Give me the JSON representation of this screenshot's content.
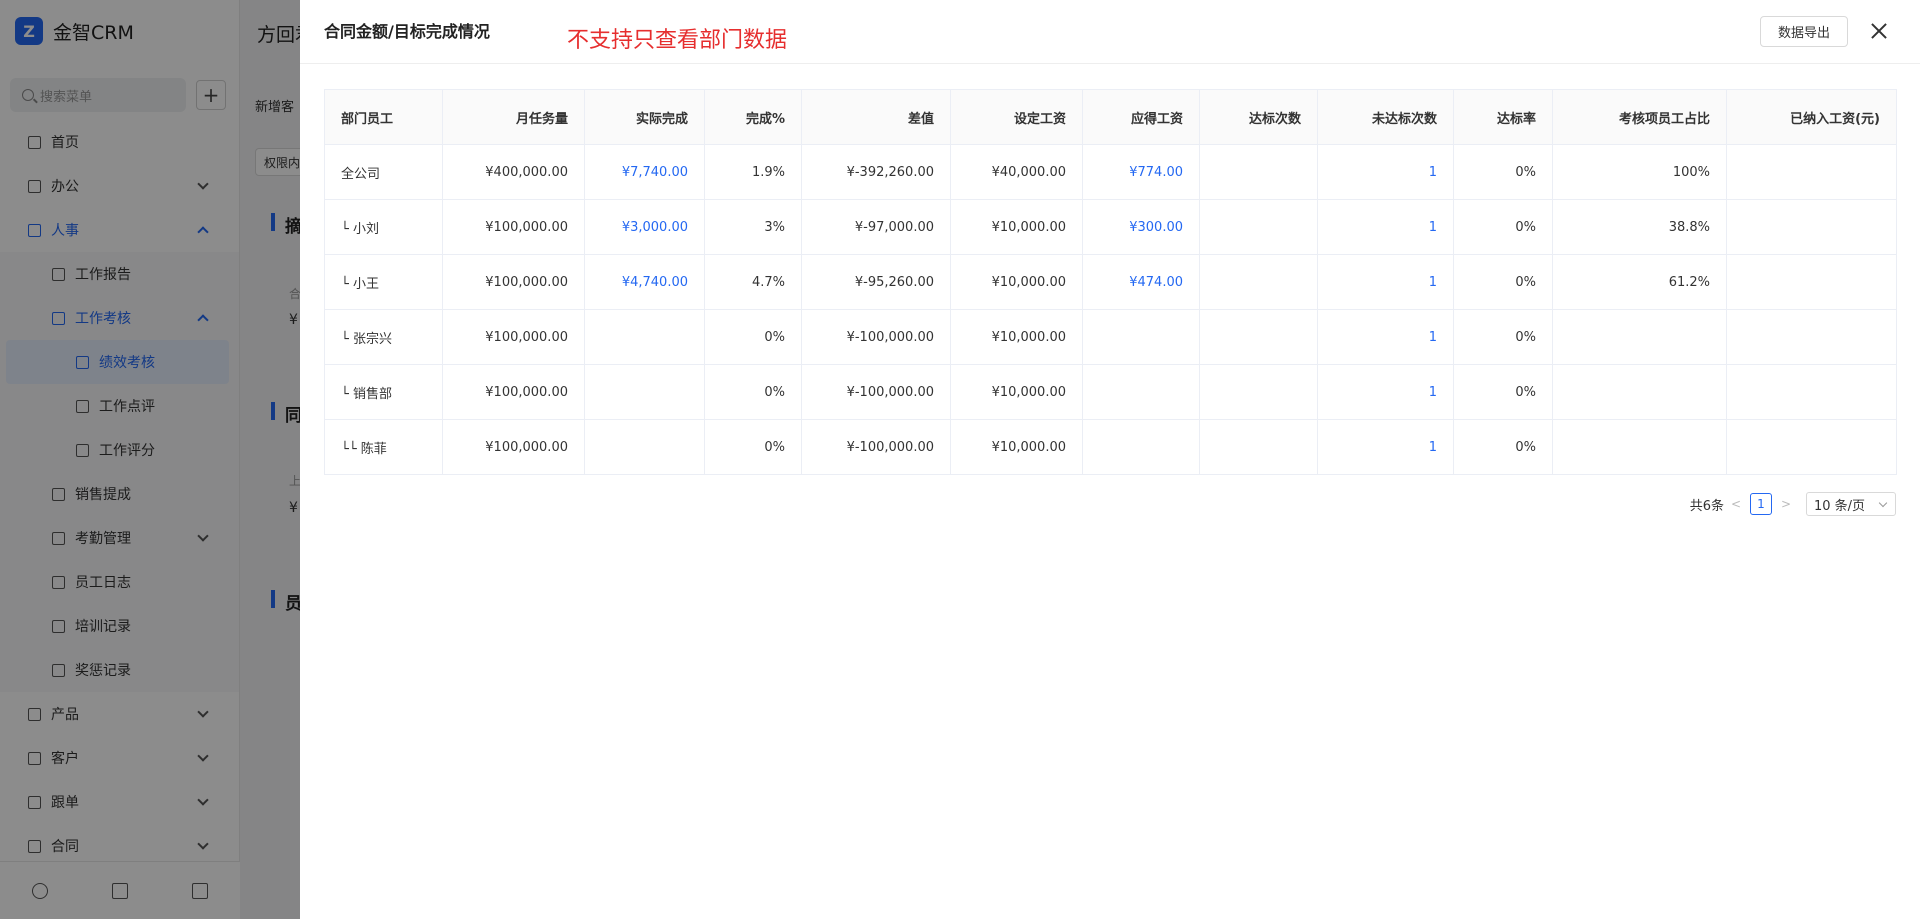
{
  "app": {
    "brand": "金智CRM",
    "logo_glyph": "Z"
  },
  "sidebar": {
    "search_placeholder": "搜索菜单",
    "items": [
      {
        "label": "首页"
      },
      {
        "label": "办公"
      },
      {
        "label": "人事"
      },
      {
        "label": "工作报告"
      },
      {
        "label": "工作考核"
      },
      {
        "label": "绩效考核"
      },
      {
        "label": "工作点评"
      },
      {
        "label": "工作评分"
      },
      {
        "label": "销售提成"
      },
      {
        "label": "考勤管理"
      },
      {
        "label": "员工日志"
      },
      {
        "label": "培训记录"
      },
      {
        "label": "奖惩记录"
      },
      {
        "label": "产品"
      },
      {
        "label": "客户"
      },
      {
        "label": "跟单"
      },
      {
        "label": "合同"
      }
    ]
  },
  "main": {
    "title": "方回君",
    "line1": "新增客",
    "perm": "权限内",
    "section1": "摘",
    "section2": "同",
    "section3": "员",
    "tiny1": "合",
    "tiny2": "¥",
    "tiny3": "上",
    "tiny4": "¥"
  },
  "drawer": {
    "title": "合同金额/目标完成情况",
    "note": "不支持只查看部门数据",
    "export_label": "数据导出"
  },
  "table": {
    "headers": [
      "部门员工",
      "月任务量",
      "实际完成",
      "完成%",
      "差值",
      "设定工资",
      "应得工资",
      "达标次数",
      "未达标次数",
      "达标率",
      "考核项员工占比",
      "已纳入工资(元)"
    ],
    "rows": [
      [
        "全公司",
        "¥400,000.00",
        "¥7,740.00",
        "1.9%",
        "¥-392,260.00",
        "¥40,000.00",
        "¥774.00",
        "",
        "1",
        "0%",
        "100%",
        ""
      ],
      [
        "└ 小刘",
        "¥100,000.00",
        "¥3,000.00",
        "3%",
        "¥-97,000.00",
        "¥10,000.00",
        "¥300.00",
        "",
        "1",
        "0%",
        "38.8%",
        ""
      ],
      [
        "└ 小王",
        "¥100,000.00",
        "¥4,740.00",
        "4.7%",
        "¥-95,260.00",
        "¥10,000.00",
        "¥474.00",
        "",
        "1",
        "0%",
        "61.2%",
        ""
      ],
      [
        "└ 张宗兴",
        "¥100,000.00",
        "",
        "0%",
        "¥-100,000.00",
        "¥10,000.00",
        "",
        "",
        "1",
        "0%",
        "",
        ""
      ],
      [
        "└ 销售部",
        "¥100,000.00",
        "",
        "0%",
        "¥-100,000.00",
        "¥10,000.00",
        "",
        "",
        "1",
        "0%",
        "",
        ""
      ],
      [
        "└└ 陈菲",
        "¥100,000.00",
        "",
        "0%",
        "¥-100,000.00",
        "¥10,000.00",
        "",
        "",
        "1",
        "0%",
        "",
        ""
      ]
    ]
  },
  "pagination": {
    "total": "共6条",
    "current": "1",
    "page_size": "10 条/页"
  },
  "colors": {
    "accent": "#2468f2",
    "note_red": "#e62e2e",
    "mask": "rgba(0,0,0,0.45)"
  }
}
